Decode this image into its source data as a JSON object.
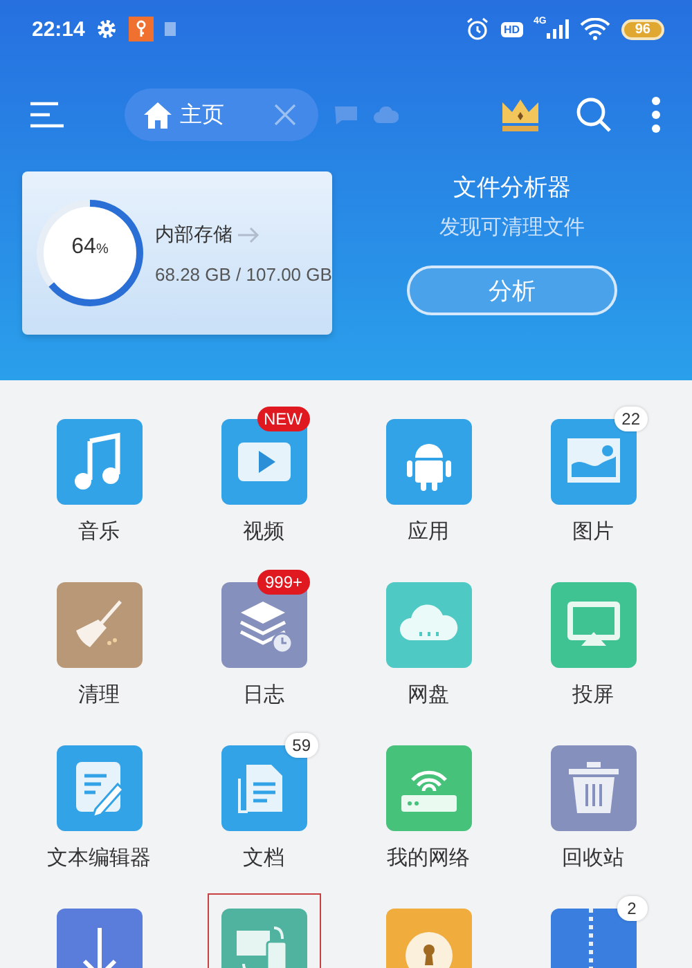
{
  "status_bar": {
    "time": "22:14",
    "hd": "HD",
    "network": "4G",
    "battery": "96"
  },
  "toolbar": {
    "tab": {
      "label": "主页",
      "selected": true
    }
  },
  "storage": {
    "percent": "64",
    "unit": "%",
    "level": 0.64,
    "title": "内部存储",
    "usage": "68.28 GB / 107.00 GB"
  },
  "analyzer": {
    "title": "文件分析器",
    "subtitle": "发现可清理文件",
    "button": "分析"
  },
  "grid": [
    {
      "kind": "music",
      "label": "音乐",
      "color": "#33a3e8",
      "selected": false
    },
    {
      "kind": "video",
      "label": "视频",
      "color": "#33a3e8",
      "selected": false,
      "badge": {
        "text": "NEW",
        "kind": "alert"
      }
    },
    {
      "kind": "app",
      "label": "应用",
      "color": "#33a3e8",
      "selected": false
    },
    {
      "kind": "image",
      "label": "图片",
      "color": "#33a3e8",
      "selected": false,
      "badge": {
        "text": "22",
        "kind": "count"
      }
    },
    {
      "kind": "clean",
      "label": "清理",
      "color": "#b99878",
      "selected": false
    },
    {
      "kind": "log",
      "label": "日志",
      "color": "#8690bd",
      "selected": false,
      "badge": {
        "text": "999+",
        "kind": "alert"
      }
    },
    {
      "kind": "cloud",
      "label": "网盘",
      "color": "#4fc9c3",
      "selected": false
    },
    {
      "kind": "cast",
      "label": "投屏",
      "color": "#3fc393",
      "selected": false
    },
    {
      "kind": "editor",
      "label": "文本编辑器",
      "color": "#33a3e8",
      "selected": false
    },
    {
      "kind": "doc",
      "label": "文档",
      "color": "#33a3e8",
      "selected": false,
      "badge": {
        "text": "59",
        "kind": "count"
      }
    },
    {
      "kind": "network",
      "label": "我的网络",
      "color": "#46c27a",
      "selected": false
    },
    {
      "kind": "trash",
      "label": "回收站",
      "color": "#8690bd",
      "selected": false
    },
    {
      "kind": "download",
      "color": "#5a7ddb",
      "selected": false
    },
    {
      "kind": "transfer",
      "color": "#4fb3a0",
      "selected": true
    },
    {
      "kind": "safe",
      "color": "#f0ac3c",
      "selected": false
    },
    {
      "kind": "zip",
      "color": "#3a7fe0",
      "selected": false,
      "badge": {
        "text": "2",
        "kind": "count"
      }
    }
  ]
}
